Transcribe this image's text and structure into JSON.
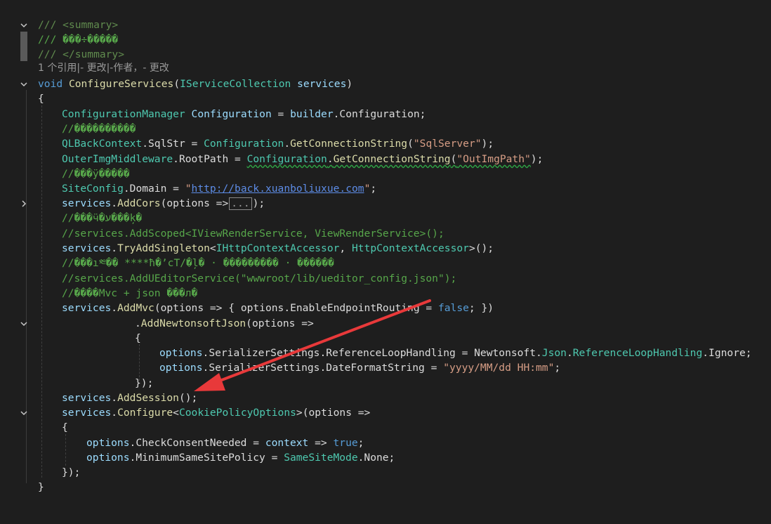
{
  "editor": {
    "codelens": "1 个引用|- 更改|-作者，- 更改",
    "doc_summary_open": "/// <summary>",
    "doc_summary_text": "/// ���÷�����",
    "doc_summary_close": "/// </summary>",
    "method": {
      "kw_void": "void",
      "name": "ConfigureServices",
      "param_type": "IServiceCollection",
      "param_name": "services"
    },
    "lines": {
      "open_brace": "{",
      "l1_type": "ConfigurationManager",
      "l1_rest_a": "Configuration",
      "l1_rest_b": " = ",
      "l1_rest_c": "builder",
      "l1_rest_d": ".Configuration;",
      "c1": "//����������",
      "l2_a": "QLBackContext",
      "l2_b": ".SqlStr = ",
      "l2_c": "Configuration",
      "l2_d": ".",
      "l2_e": "GetConnectionString",
      "l2_f": "(",
      "l2_g": "\"SqlServer\"",
      "l2_h": ");",
      "l3_a": "OuterImgMiddleware",
      "l3_b": ".RootPath = ",
      "l3_c": "Configuration",
      "l3_d": ".",
      "l3_e": "GetConnectionString",
      "l3_f": "(",
      "l3_g": "\"OutImgPath\"",
      "l3_h": ");",
      "c2": "//���ÿ�����",
      "l4_a": "SiteConfig",
      "l4_b": ".Domain = ",
      "l4_c": "\"",
      "l4_d": "http://back.xuanboliuxue.com",
      "l4_e": "\"",
      "l4_f": ";",
      "l5_a": "services",
      "l5_b": ".",
      "l5_c": "AddCors",
      "l5_d": "(options =>",
      "l5_collapsed": "...",
      "l5_e": ");",
      "c3": "//���ӵ�ע���ķ�",
      "c4": "//services.AddScoped<IViewRenderService, ViewRenderService>();",
      "l6_a": "services",
      "l6_b": ".",
      "l6_c": "TryAddSingleton",
      "l6_d": "<",
      "l6_e": "IHttpContextAccessor",
      "l6_f": ", ",
      "l6_g": "HttpContextAccessor",
      "l6_h": ">();",
      "c5": "//���ı༭�� ****ħ�ʼcT/�ļ� · ��������� · ������",
      "c6": "//services.AddUEditorService(\"wwwroot/lib/ueditor_config.json\");",
      "c7": "//����Mvc + json ���л�",
      "l7_a": "services",
      "l7_b": ".",
      "l7_c": "AddMvc",
      "l7_d": "(options => { options.",
      "l7_e": "EnableEndpointRouting",
      "l7_f": " = ",
      "l7_g": "false",
      "l7_h": "; })",
      "l8_a": ".",
      "l8_b": "AddNewtonsoftJson",
      "l8_c": "(options =>",
      "l9": "{",
      "l10_a": "options",
      "l10_b": ".",
      "l10_c": "SerializerSettings",
      "l10_d": ".",
      "l10_e": "ReferenceLoopHandling",
      "l10_f": " = Newtonsoft.",
      "l10_g": "Json",
      "l10_h": ".",
      "l10_i": "ReferenceLoopHandling",
      "l10_j": ".Ignore;",
      "l11_a": "options",
      "l11_b": ".",
      "l11_c": "SerializerSettings",
      "l11_d": ".",
      "l11_e": "DateFormatString",
      "l11_f": " = ",
      "l11_g": "\"yyyy/MM/dd HH:mm\"",
      "l11_h": ";",
      "l12": "});",
      "l13_a": "services",
      "l13_b": ".",
      "l13_c": "AddSession",
      "l13_d": "();",
      "l14_a": "services",
      "l14_b": ".",
      "l14_c": "Configure",
      "l14_d": "<",
      "l14_e": "CookiePolicyOptions",
      "l14_f": ">(options =>",
      "l15": "{",
      "l16_a": "options",
      "l16_b": ".",
      "l16_c": "CheckConsentNeeded",
      "l16_d": " = ",
      "l16_e": "context",
      "l16_f": " => ",
      "l16_g": "true",
      "l16_h": ";",
      "l17_a": "options",
      "l17_b": ".",
      "l17_c": "MinimumSameSitePolicy",
      "l17_d": " = ",
      "l17_e": "SameSiteMode",
      "l17_f": ".None;",
      "l18": "});",
      "close_brace": "}"
    }
  },
  "annotation": {
    "arrow_color": "#e8393a"
  },
  "colors": {
    "background": "#1e1e1e",
    "comment": "#57a64a",
    "keyword": "#569cd6",
    "type": "#4ec9b0",
    "method": "#dcdcaa",
    "string": "#d69d85"
  }
}
